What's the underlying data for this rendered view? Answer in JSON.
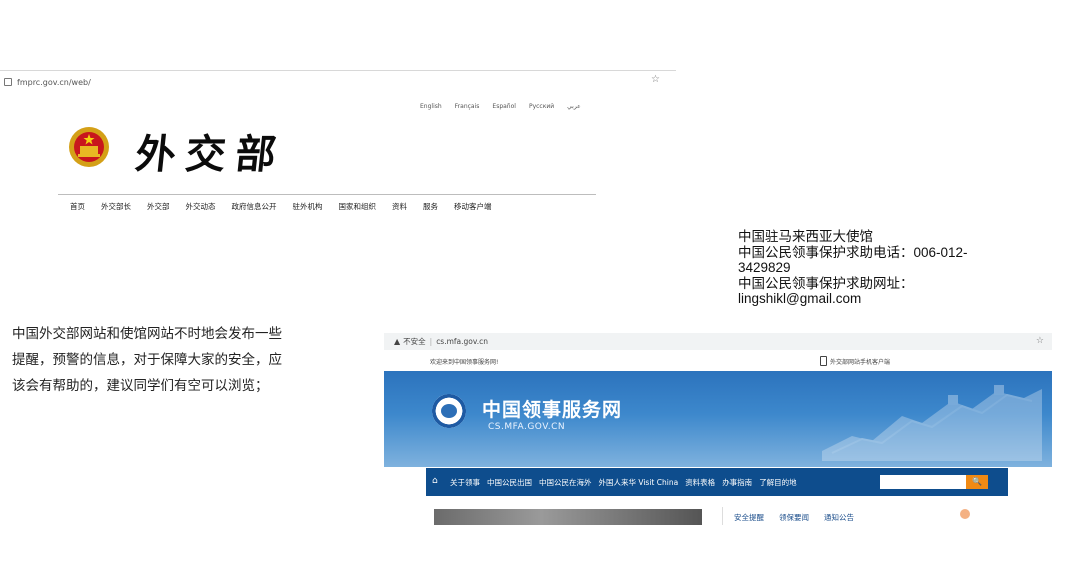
{
  "shot1": {
    "url": "fmprc.gov.cn/web/",
    "star": "☆",
    "languages": [
      "English",
      "Français",
      "Español",
      "Pусский",
      "عربي"
    ],
    "logo_text": "外交部",
    "nav": [
      "首页",
      "外交部长",
      "外交部",
      "外交动态",
      "政府信息公开",
      "驻外机构",
      "国家和组织",
      "资料",
      "服务",
      "移动客户端"
    ]
  },
  "embassy": {
    "line1": "中国驻马来西亚大使馆",
    "line2": "中国公民领事保护求助电话：006-012-",
    "line3": "3429829",
    "line4": "中国公民领事保护求助网址：",
    "line5": "lingshikl@gmail.com"
  },
  "paragraph": {
    "line1": "中国外交部网站和使馆网站不时地会发布一些",
    "line2": "提醒，预警的信息，对于保障大家的安全，应",
    "line3": "该会有帮助的，建议同学们有空可以浏览；"
  },
  "shot2": {
    "security": "不安全",
    "url": "cs.mfa.gov.cn",
    "star": "☆",
    "welcome": "欢迎来到中国领事服务网!",
    "phone_link": "外交部网站手机客户端",
    "site_title": "中国领事服务网",
    "site_domain": "CS.MFA.GOV.CN",
    "nav": [
      "关于领事",
      "中国公民出国",
      "中国公民在海外",
      "外国人来华 Visit China",
      "资料表格",
      "办事指南",
      "了解目的地"
    ],
    "tabs": [
      "安全提醒",
      "领保要闻",
      "通知公告"
    ]
  }
}
